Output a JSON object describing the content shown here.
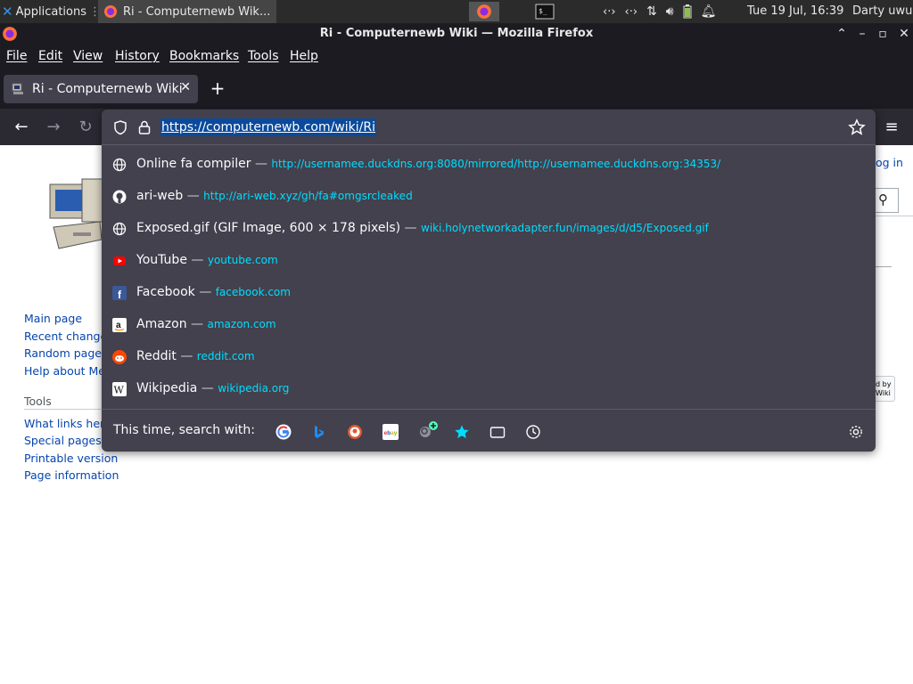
{
  "panel": {
    "applications_label": "Applications",
    "task_title": "Ri - Computernewb Wik...",
    "clock": "Tue 19 Jul, 16:39",
    "user": "Darty uwu"
  },
  "window": {
    "title": "Ri - Computernewb Wiki — Mozilla Firefox"
  },
  "menubar": {
    "items": [
      "File",
      "Edit",
      "View",
      "History",
      "Bookmarks",
      "Tools",
      "Help"
    ]
  },
  "tabs": [
    {
      "label": "Ri - Computernewb Wiki"
    }
  ],
  "urlbar": {
    "value": "https://computernewb.com/wiki/Ri"
  },
  "suggestions": [
    {
      "title": "Online fa compiler",
      "url": "http://usernamee.duckdns.org:8080/mirrored/http://usernamee.duckdns.org:34353/",
      "icon": "globe-icon"
    },
    {
      "title": "ari-web",
      "url": "http://ari-web.xyz/gh/fa#omgsrcleaked",
      "icon": "github-icon"
    },
    {
      "title": "Exposed.gif (GIF Image, 600 × 178 pixels)",
      "url": "wiki.holynetworkadapter.fun/images/d/d5/Exposed.gif",
      "icon": "globe-icon"
    },
    {
      "title": "YouTube",
      "url": "youtube.com",
      "icon": "youtube-icon"
    },
    {
      "title": "Facebook",
      "url": "facebook.com",
      "icon": "facebook-icon"
    },
    {
      "title": "Amazon",
      "url": "amazon.com",
      "icon": "amazon-icon"
    },
    {
      "title": "Reddit",
      "url": "reddit.com",
      "icon": "reddit-icon"
    },
    {
      "title": "Wikipedia",
      "url": "wikipedia.org",
      "icon": "wikipedia-icon"
    }
  ],
  "separator": "—",
  "search_with": {
    "label": "This time, search with:",
    "engines": [
      "google-icon",
      "bing-icon",
      "duckduckgo-icon",
      "ebay-icon",
      "add-search-engine-icon",
      "bookmarks-icon",
      "tabs-icon",
      "history-icon"
    ]
  },
  "wiki": {
    "nav_links": [
      "Main page",
      "Recent changes",
      "Random page",
      "Help about MediaWiki"
    ],
    "tools_heading": "Tools",
    "tools_links": [
      "What links here",
      "Special pages",
      "Printable version",
      "Page information"
    ],
    "login_text": "og in",
    "powered_text": "d by\nWiki"
  },
  "colors": {
    "dark_bg": "#1c1b22",
    "toolbar_bg": "#2b2a33",
    "popup_bg": "#42414d",
    "url_accent": "#00ddff",
    "link_blue": "#0645ad"
  }
}
